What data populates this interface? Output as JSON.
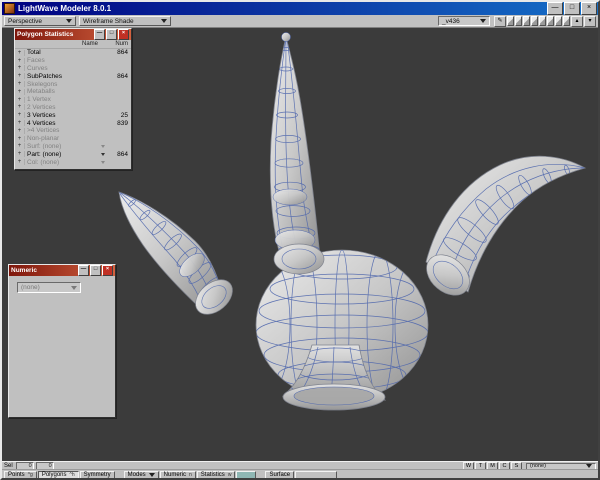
{
  "window": {
    "title": "LightWave Modeler 8.0.1"
  },
  "window_controls": {
    "min": "—",
    "max": "□",
    "close": "×"
  },
  "panel_controls": {
    "min": "—",
    "max": "□",
    "close": "×"
  },
  "toolbar": {
    "view_mode": "Perspective",
    "shade_mode": "Wireframe Shade",
    "object_name": "_v436"
  },
  "stats_panel": {
    "title": "Polygon Statistics",
    "plus": "+",
    "header": {
      "name": "Name",
      "num": "Num"
    },
    "rows": [
      {
        "label": "Total",
        "value": "864"
      },
      {
        "label": "Faces",
        "value": ""
      },
      {
        "label": "Curves",
        "value": ""
      },
      {
        "label": "SubPatches",
        "value": "864"
      },
      {
        "label": "Skelegons",
        "value": ""
      },
      {
        "label": "Metaballs",
        "value": ""
      },
      {
        "label": "1 Vertex",
        "value": ""
      },
      {
        "label": "2 Vertices",
        "value": ""
      },
      {
        "label": "3 Vertices",
        "value": "25"
      },
      {
        "label": "4 Vertices",
        "value": "839"
      },
      {
        "label": ">4 Vertices",
        "value": ""
      },
      {
        "label": "Non-planar",
        "value": ""
      },
      {
        "label": "Surf: (none)",
        "value": ""
      },
      {
        "label": "Part: (none)",
        "value": "864"
      },
      {
        "label": "Col: (none)",
        "value": ""
      }
    ]
  },
  "numeric_panel": {
    "title": "Numeric",
    "tool_dropdown": "(none)"
  },
  "status_row": {
    "sel_label": "Sel",
    "count1": "0",
    "count2": "0",
    "letters": [
      "W",
      "T",
      "M",
      "C",
      "S"
    ],
    "vmap_selected": "(none)"
  },
  "mode_row": {
    "points": "Points",
    "points_key": "^g",
    "polygons": "Polygons",
    "polygons_key": "^h",
    "symmetry": "Symmetry",
    "modes": "Modes",
    "numeric": "Numeric",
    "numeric_key": "n",
    "statistics": "Statistics",
    "statistics_key": "w",
    "surface": "Surface"
  },
  "colors": {
    "viewport_bg": "#3b3b3b",
    "wireframe": "#4f67ad",
    "panel_title_gradient": [
      "#7e160b",
      "#d2613f"
    ],
    "titlebar_gradient": [
      "#000080",
      "#1670c8"
    ]
  }
}
